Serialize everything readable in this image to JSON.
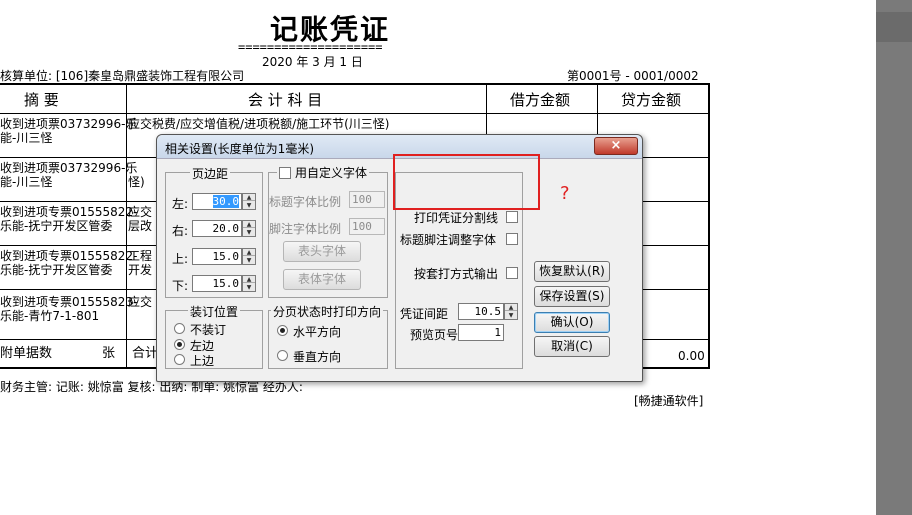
{
  "voucher": {
    "title": "记账凭证",
    "title_underline": "====================",
    "date": "2020 年  3  月  1 日",
    "unit": "核算单位: [106]秦皇岛鼎盛装饰工程有限公司",
    "doc_no": "第0001号 - 0001/0002",
    "headers": {
      "summary": "摘    要",
      "account": "会  计  科  目",
      "debit": "借方金额",
      "credit": "贷方金额"
    },
    "rows": [
      {
        "summary": [
          "收到进项票03732996-乐",
          "能-川三怪"
        ],
        "account": [
          "应交税费/应交增值税/进项税额/施工环节(川三怪)",
          ""
        ]
      },
      {
        "summary": [
          "收到进项票03732996-乐",
          "能-川三怪"
        ],
        "account": [
          "",
          "怪)"
        ]
      },
      {
        "summary": [
          "收到进项专票01555822-",
          "乐能-抚宁开发区管委"
        ],
        "account": [
          "应交",
          "层改"
        ]
      },
      {
        "summary": [
          "收到进项专票01555822-",
          "乐能-抚宁开发区管委"
        ],
        "account": [
          "工程",
          "开发"
        ]
      },
      {
        "summary": [
          "收到进项专票01555823-",
          "乐能-青竹7-1-801"
        ],
        "account": [
          "应交",
          ""
        ]
      }
    ],
    "total_label_left": "附单据数",
    "total_unit": "张",
    "total_label_mid": "合计",
    "total_value": "0.00",
    "footer": "财务主管:                       记账: 姚惊富      复核:                     出纳:                        制单: 姚惊富      经办人:",
    "brand": "[畅捷通软件]"
  },
  "dialog": {
    "title": "相关设置(长度单位为1毫米)",
    "close_symbol": "×",
    "margins": {
      "label": "页边距",
      "left_label": "左:",
      "left_value": "30.0",
      "right_label": "右:",
      "right_value": "20.0",
      "top_label": "上:",
      "top_value": "15.0",
      "bottom_label": "下:",
      "bottom_value": "15.0"
    },
    "custom_font": {
      "label": "用自定义字体",
      "title_ratio_label": "标题字体比例",
      "title_ratio_value": "100",
      "footer_ratio_label": "脚注字体比例",
      "footer_ratio_value": "100",
      "header_font_button": "表头字体",
      "body_font_button": "表体字体"
    },
    "binding": {
      "label": "装订位置",
      "options": [
        "不装订",
        "左边",
        "上边"
      ],
      "selected": "左边"
    },
    "direction": {
      "label": "分页状态时打印方向",
      "options": [
        "水平方向",
        "垂直方向"
      ],
      "selected": "水平方向"
    },
    "options": {
      "print_divider": "打印凭证分割线",
      "adjust_footer_font": "标题脚注调整字体",
      "print_by_template": "按套打方式输出"
    },
    "spacing_label": "凭证间距",
    "spacing_value": "10.5",
    "preview_page_label": "预览页号",
    "preview_page_value": "1",
    "buttons": {
      "restore": "恢复默认(R)",
      "save": "保存设置(S)",
      "ok": "确认(O)",
      "cancel": "取消(C)"
    }
  },
  "annotation": {
    "mark": "?",
    "color": "#e02020"
  }
}
